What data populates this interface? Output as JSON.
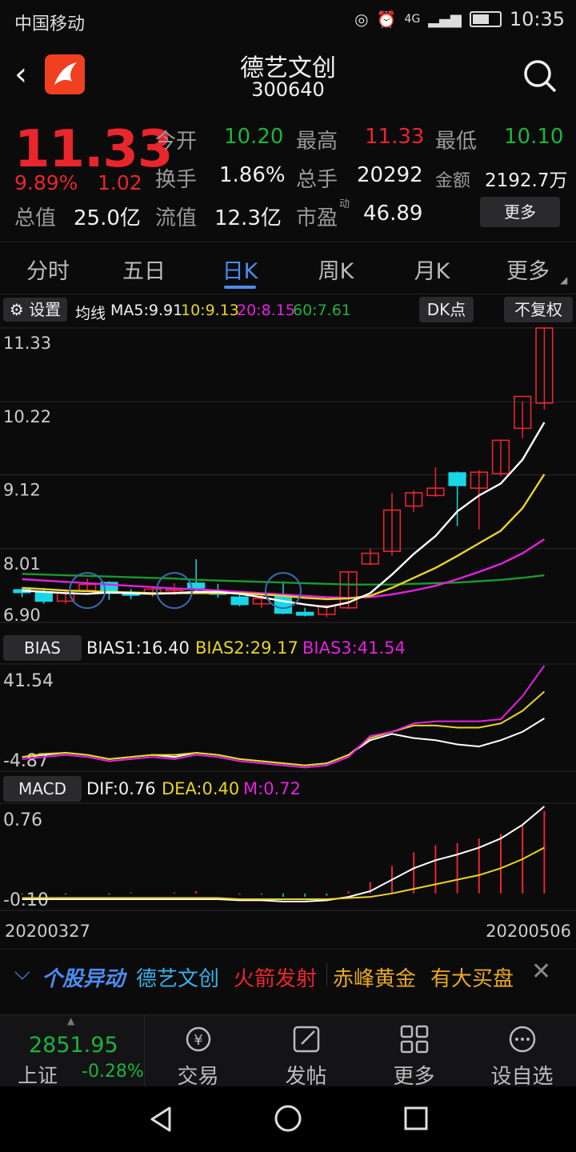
{
  "status": {
    "carrier": "中国移动",
    "time": "10:35",
    "signal": "4G"
  },
  "header": {
    "title": "德艺文创",
    "code": "300640"
  },
  "quote": {
    "price": "11.33",
    "pct": "9.89%",
    "change": "1.02",
    "open_label": "今开",
    "open": "10.20",
    "high_label": "最高",
    "high": "11.33",
    "low_label": "最低",
    "low": "10.10",
    "turnover_label": "换手",
    "turnover": "1.86%",
    "volume_label": "总手",
    "volume": "20292",
    "amount_label": "金额",
    "amount": "2192.7万",
    "mktcap_label": "总值",
    "mktcap": "25.0亿",
    "float_label": "流值",
    "float": "12.3亿",
    "pe_label": "市盈",
    "pe_sup": "动",
    "pe": "46.89",
    "more_label": "更多"
  },
  "tabs": [
    "分时",
    "五日",
    "日K",
    "周K",
    "月K",
    "更多"
  ],
  "ma": {
    "settings_label": "设置",
    "prefix": "均线",
    "ma5": "MA5:9.91",
    "ma10": "10:9.13",
    "ma20": "20:8.15",
    "ma60": "60:7.61",
    "dk_label": "DK点",
    "adjust_label": "不复权"
  },
  "bias": {
    "label": "BIAS",
    "b1": "BIAS1:16.40",
    "b2": "BIAS2:29.17",
    "b3": "BIAS3:41.54"
  },
  "macd": {
    "label": "MACD",
    "dif": "DIF:0.76",
    "dea": "DEA:0.40",
    "m": "M:0.72"
  },
  "dates": {
    "start": "20200327",
    "end": "20200506"
  },
  "ticker": {
    "brand": "个股异动",
    "stock": "德艺文创",
    "t1": "火箭发射",
    "t2": "赤峰黄金",
    "t3": "有大买盘"
  },
  "bottom": {
    "index_value": "2851.95",
    "index_name": "上证",
    "index_change": "-0.28%",
    "trade": "交易",
    "post": "发帖",
    "more": "更多",
    "watch": "设自选"
  },
  "colors": {
    "up": "#e8262c",
    "down": "#1db33a",
    "accent": "#4a8cf0",
    "ma5": "#ffffff",
    "ma10": "#e8d422",
    "ma20": "#e620e0",
    "ma60": "#1a9a2a",
    "down_candle": "#19d6e6"
  },
  "chart_data": [
    {
      "type": "candlestick",
      "title": "",
      "x_range": [
        "20200327",
        "20200506"
      ],
      "y_ticks": [
        "11.33",
        "10.22",
        "9.12",
        "8.01",
        "6.90"
      ],
      "ylim": [
        6.9,
        11.33
      ],
      "candles": [
        [
          7.39,
          7.42,
          7.28,
          7.35
        ],
        [
          7.36,
          7.42,
          7.18,
          7.22
        ],
        [
          7.22,
          7.4,
          7.18,
          7.35
        ],
        [
          7.38,
          7.56,
          7.36,
          7.47
        ],
        [
          7.5,
          7.52,
          7.24,
          7.34
        ],
        [
          7.34,
          7.4,
          7.25,
          7.31
        ],
        [
          7.33,
          7.44,
          7.28,
          7.4
        ],
        [
          7.38,
          7.49,
          7.31,
          7.4
        ],
        [
          7.49,
          7.85,
          7.36,
          7.42
        ],
        [
          7.35,
          7.48,
          7.27,
          7.33
        ],
        [
          7.28,
          7.36,
          7.14,
          7.17
        ],
        [
          7.18,
          7.35,
          7.12,
          7.26
        ],
        [
          7.3,
          7.52,
          7.02,
          7.04
        ],
        [
          7.05,
          7.12,
          6.99,
          7.01
        ],
        [
          7.02,
          7.16,
          6.98,
          7.15
        ],
        [
          7.12,
          7.66,
          7.1,
          7.66
        ],
        [
          7.78,
          8.01,
          7.76,
          7.94
        ],
        [
          7.97,
          8.85,
          7.9,
          8.59
        ],
        [
          8.65,
          8.89,
          8.56,
          8.85
        ],
        [
          8.81,
          9.23,
          8.79,
          8.92
        ],
        [
          9.15,
          9.17,
          8.35,
          8.96
        ],
        [
          8.92,
          9.19,
          8.3,
          9.16
        ],
        [
          9.14,
          9.65,
          9.1,
          9.64
        ],
        [
          9.82,
          10.22,
          9.67,
          10.3
        ],
        [
          10.2,
          11.33,
          10.1,
          11.33
        ]
      ],
      "ma5": [
        7.38,
        7.36,
        7.34,
        7.33,
        7.35,
        7.34,
        7.33,
        7.34,
        7.36,
        7.36,
        7.33,
        7.28,
        7.22,
        7.17,
        7.13,
        7.2,
        7.34,
        7.62,
        7.93,
        8.2,
        8.57,
        8.81,
        8.99,
        9.35,
        9.91
      ],
      "ma10": [
        7.42,
        7.4,
        7.38,
        7.37,
        7.36,
        7.35,
        7.34,
        7.34,
        7.34,
        7.34,
        7.34,
        7.32,
        7.3,
        7.27,
        7.25,
        7.26,
        7.3,
        7.42,
        7.57,
        7.72,
        7.9,
        8.09,
        8.28,
        8.62,
        9.13
      ],
      "ma20": [
        7.55,
        7.53,
        7.51,
        7.49,
        7.47,
        7.45,
        7.43,
        7.41,
        7.4,
        7.38,
        7.36,
        7.34,
        7.32,
        7.3,
        7.28,
        7.27,
        7.28,
        7.32,
        7.38,
        7.45,
        7.55,
        7.66,
        7.78,
        7.94,
        8.15
      ],
      "ma60": [
        7.63,
        7.62,
        7.61,
        7.6,
        7.59,
        7.58,
        7.57,
        7.56,
        7.54,
        7.53,
        7.52,
        7.51,
        7.5,
        7.49,
        7.48,
        7.47,
        7.47,
        7.47,
        7.48,
        7.49,
        7.5,
        7.52,
        7.54,
        7.57,
        7.61
      ]
    },
    {
      "type": "line",
      "title": "BIAS",
      "y_ticks": [
        "41.54",
        "-4.87"
      ],
      "ylim": [
        -8,
        41.54
      ],
      "series": [
        {
          "name": "BIAS1",
          "values": [
            -2,
            -1,
            0,
            -1,
            -3,
            -2,
            -1,
            -2,
            0,
            -1,
            -3,
            -4,
            -5,
            -6,
            -5,
            -1,
            6,
            9,
            7,
            6,
            4,
            3,
            6,
            10,
            16.4
          ]
        },
        {
          "name": "BIAS2",
          "values": [
            -2,
            -0.5,
            0,
            -1,
            -3,
            -2,
            -1,
            -1,
            0,
            -1,
            -3,
            -4,
            -5,
            -6,
            -5,
            -1,
            7,
            10,
            13,
            13,
            12,
            12,
            14,
            20,
            29.17
          ]
        },
        {
          "name": "BIAS3",
          "values": [
            -3,
            -2,
            -1,
            -2,
            -4,
            -3,
            -2,
            -3,
            -1,
            -2,
            -4,
            -5,
            -6,
            -7,
            -6,
            -2,
            8,
            10,
            14,
            15,
            15,
            15,
            16,
            27,
            41.54
          ]
        }
      ]
    },
    {
      "type": "line",
      "title": "MACD",
      "y_ticks": [
        "0.76",
        "-0.10"
      ],
      "ylim": [
        -0.12,
        0.76
      ],
      "series": [
        {
          "name": "DIF",
          "values": [
            -0.05,
            -0.05,
            -0.05,
            -0.05,
            -0.05,
            -0.05,
            -0.05,
            -0.05,
            -0.05,
            -0.05,
            -0.06,
            -0.06,
            -0.07,
            -0.07,
            -0.06,
            -0.03,
            0.02,
            0.12,
            0.22,
            0.29,
            0.34,
            0.4,
            0.48,
            0.6,
            0.76
          ]
        },
        {
          "name": "DEA",
          "values": [
            -0.04,
            -0.04,
            -0.04,
            -0.04,
            -0.04,
            -0.04,
            -0.04,
            -0.04,
            -0.04,
            -0.04,
            -0.05,
            -0.05,
            -0.05,
            -0.05,
            -0.05,
            -0.04,
            -0.03,
            0.0,
            0.04,
            0.08,
            0.12,
            0.16,
            0.22,
            0.3,
            0.4
          ]
        },
        {
          "name": "M",
          "values": [
            -0.01,
            0,
            -0.01,
            0,
            -0.01,
            0.01,
            0,
            0.01,
            0.02,
            0,
            -0.01,
            -0.01,
            -0.03,
            -0.03,
            -0.02,
            0.02,
            0.1,
            0.24,
            0.36,
            0.42,
            0.44,
            0.48,
            0.52,
            0.6,
            0.72
          ]
        }
      ]
    }
  ]
}
